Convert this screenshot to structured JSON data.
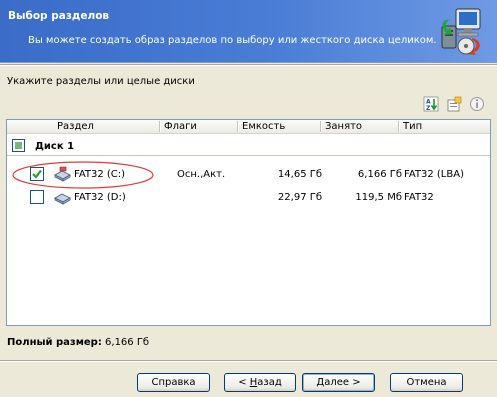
{
  "header": {
    "title": "Выбор разделов",
    "subtitle": "Вы можете создать образ разделов по выбору или жесткого диска целиком."
  },
  "prompt": "Укажите разделы или целые диски",
  "columns": [
    "Раздел",
    "Флаги",
    "Емкость",
    "Занято",
    "Тип"
  ],
  "disk": {
    "label": "Диск 1"
  },
  "partitions": [
    {
      "name": "FAT32 (C:)",
      "flags": "Осн.,Акт.",
      "capacity": "14,65 Гб",
      "used": "6,166 Гб",
      "type": "FAT32 (LBA)",
      "checked": true
    },
    {
      "name": "FAT32 (D:)",
      "flags": "",
      "capacity": "22,97 Гб",
      "used": "119,5 Мб",
      "type": "FAT32",
      "checked": false
    }
  ],
  "total": {
    "label": "Полный размер:",
    "value": "6,166 Гб"
  },
  "buttons": {
    "help": "Справка",
    "back_prefix": "< ",
    "back_key": "Н",
    "back_rest": "азад",
    "next_key": "Д",
    "next_rest": "алее >",
    "cancel": "Отмена"
  },
  "icons": {
    "sort": "sort-az-icon",
    "properties": "properties-icon",
    "info": "info-icon",
    "logo": "computer-disk-wizard-icon",
    "partition": "partition-drive-icon"
  },
  "colors": {
    "header_bg": "#3a6cc8",
    "window_bg": "#ece9d8",
    "highlight_ellipse": "#e03a3a",
    "check_green": "#2f9c2f"
  }
}
